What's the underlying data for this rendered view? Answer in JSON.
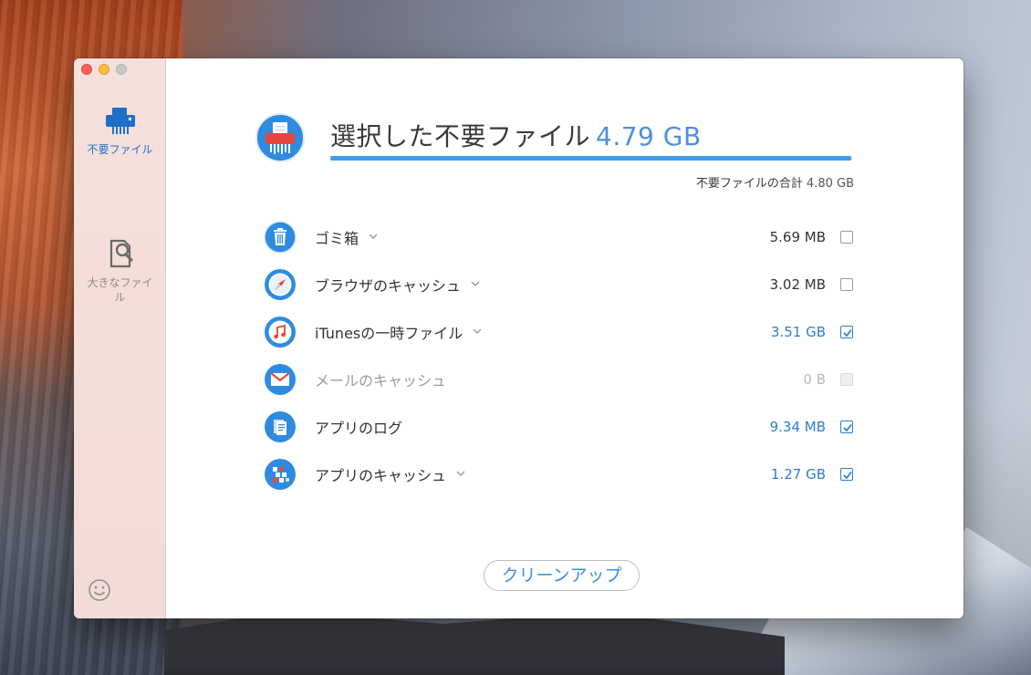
{
  "sidebar": {
    "items": [
      {
        "label": "不要ファイル",
        "icon": "printer-shredder-icon",
        "active": true
      },
      {
        "label": "大きなファイル",
        "icon": "file-search-icon",
        "active": false
      }
    ],
    "footer_icon": "smiley-icon"
  },
  "header": {
    "title": "選択した不要ファイル",
    "selected_size": "4.79 GB",
    "progress_fraction": 0.998,
    "total_label": "不要ファイルの合計",
    "total_size": "4.80 GB",
    "icon": "shredder-icon"
  },
  "items": [
    {
      "name": "ゴミ箱",
      "size": "5.69 MB",
      "checked": false,
      "enabled": true,
      "expandable": true,
      "icon": "trash-icon"
    },
    {
      "name": "ブラウザのキャッシュ",
      "size": "3.02 MB",
      "checked": false,
      "enabled": true,
      "expandable": true,
      "icon": "safari-compass-icon"
    },
    {
      "name": "iTunesの一時ファイル",
      "size": "3.51 GB",
      "checked": true,
      "enabled": true,
      "expandable": true,
      "icon": "itunes-music-icon"
    },
    {
      "name": "メールのキャッシュ",
      "size": "0 B",
      "checked": false,
      "enabled": false,
      "expandable": false,
      "icon": "mail-envelope-icon"
    },
    {
      "name": "アプリのログ",
      "size": "9.34 MB",
      "checked": true,
      "enabled": true,
      "expandable": false,
      "icon": "document-log-icon"
    },
    {
      "name": "アプリのキャッシュ",
      "size": "1.27 GB",
      "checked": true,
      "enabled": true,
      "expandable": true,
      "icon": "cache-blocks-icon"
    }
  ],
  "clean_button": "クリーンアップ",
  "colors": {
    "accent": "#3f9cec",
    "size_blue": "#2b7fd4",
    "sidebar_bg": "#f6e0dc"
  }
}
